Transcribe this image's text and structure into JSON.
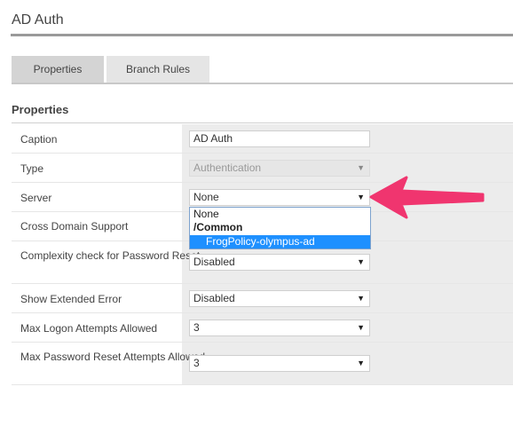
{
  "header": {
    "title": "AD Auth"
  },
  "tabs": [
    {
      "label": "Properties",
      "active": true
    },
    {
      "label": "Branch Rules",
      "active": false
    }
  ],
  "section": {
    "title": "Properties"
  },
  "fields": {
    "caption": {
      "label": "Caption",
      "value": "AD Auth"
    },
    "type": {
      "label": "Type",
      "value": "Authentication",
      "disabled": true
    },
    "server": {
      "label": "Server",
      "value": "None"
    },
    "cross_domain": {
      "label": "Cross Domain Support",
      "value": ""
    },
    "complexity": {
      "label": "Complexity check for Password Reset",
      "value": "Disabled"
    },
    "extended_error": {
      "label": "Show Extended Error",
      "value": "Disabled"
    },
    "max_logon": {
      "label": "Max Logon Attempts Allowed",
      "value": "3"
    },
    "max_reset": {
      "label": "Max Password Reset Attempts Allowed",
      "value": "3"
    }
  },
  "server_dropdown": {
    "options": [
      {
        "label": "None",
        "type": "option"
      },
      {
        "label": "/Common",
        "type": "group"
      },
      {
        "label": "FrogPolicy-olympus-ad",
        "type": "option",
        "selected": true
      }
    ]
  },
  "icons": {
    "caret": "chevron-down-icon",
    "annotation": "pink-arrow-icon"
  },
  "colors": {
    "annotation_arrow": "#f0356f",
    "selected_option": "#1e90ff"
  }
}
